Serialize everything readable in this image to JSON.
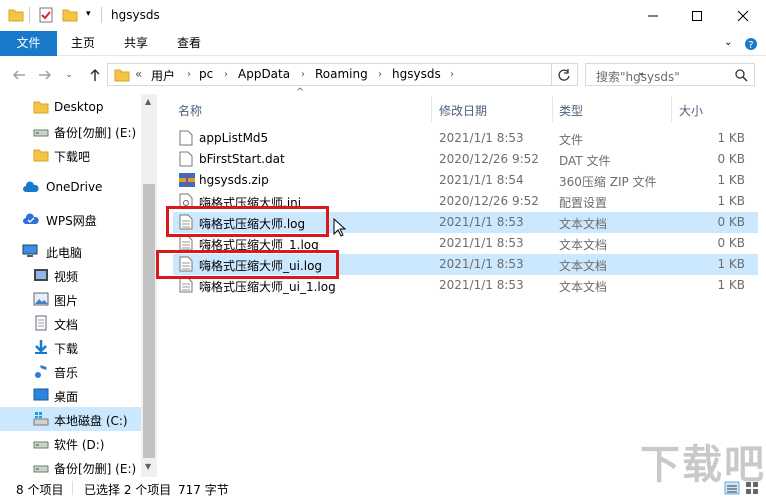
{
  "window": {
    "title": "hgsysds",
    "controls": [
      "minimize",
      "maximize",
      "close"
    ]
  },
  "ribbon": {
    "tabs": [
      {
        "label": "文件",
        "active": true
      },
      {
        "label": "主页"
      },
      {
        "label": "共享"
      },
      {
        "label": "查看"
      }
    ]
  },
  "address": {
    "overflow": "«",
    "crumbs": [
      "用户",
      "pc",
      "AppData",
      "Roaming",
      "hgsysds"
    ],
    "search_placeholder": "搜索\"hgsysds\""
  },
  "navpane": {
    "items": [
      {
        "label": "Desktop",
        "icon": "folder-icon"
      },
      {
        "label": "备份[勿删] (E:)",
        "icon": "drive-icon"
      },
      {
        "label": "下载吧",
        "icon": "folder-icon"
      },
      {
        "label": "OneDrive",
        "icon": "cloud-icon"
      },
      {
        "label": "WPS网盘",
        "icon": "wps-cloud-icon"
      },
      {
        "label": "此电脑",
        "icon": "computer-icon"
      },
      {
        "label": "视频",
        "icon": "video-icon"
      },
      {
        "label": "图片",
        "icon": "pictures-icon"
      },
      {
        "label": "文档",
        "icon": "documents-icon"
      },
      {
        "label": "下载",
        "icon": "download-icon"
      },
      {
        "label": "音乐",
        "icon": "music-icon"
      },
      {
        "label": "桌面",
        "icon": "desktop-icon"
      },
      {
        "label": "本地磁盘 (C:)",
        "icon": "system-drive-icon",
        "selected": true
      },
      {
        "label": "软件 (D:)",
        "icon": "drive-icon"
      },
      {
        "label": "备份[勿删] (E:)",
        "icon": "drive-icon"
      }
    ]
  },
  "filelist": {
    "columns": [
      "名称",
      "修改日期",
      "类型",
      "大小"
    ],
    "rows": [
      {
        "name": "appListMd5",
        "date": "2021/1/1 8:53",
        "type": "文件",
        "size": "1 KB",
        "icon": "file-icon"
      },
      {
        "name": "bFirstStart.dat",
        "date": "2020/12/26 9:52",
        "type": "DAT 文件",
        "size": "0 KB",
        "icon": "file-icon"
      },
      {
        "name": "hgsysds.zip",
        "date": "2021/1/1 8:54",
        "type": "360压缩 ZIP 文件",
        "size": "1 KB",
        "icon": "zip-icon"
      },
      {
        "name": "嗨格式压缩大师.ini",
        "date": "2020/12/26 9:52",
        "type": "配置设置",
        "size": "1 KB",
        "icon": "settings-file-icon"
      },
      {
        "name": "嗨格式压缩大师.log",
        "date": "2021/1/1 8:53",
        "type": "文本文档",
        "size": "0 KB",
        "icon": "text-file-icon",
        "selected": true
      },
      {
        "name": "嗨格式压缩大师_1.log",
        "date": "2021/1/1 8:53",
        "type": "文本文档",
        "size": "0 KB",
        "icon": "text-file-icon"
      },
      {
        "name": "嗨格式压缩大师_ui.log",
        "date": "2021/1/1 8:53",
        "type": "文本文档",
        "size": "1 KB",
        "icon": "text-file-icon",
        "selected": true
      },
      {
        "name": "嗨格式压缩大师_ui_1.log",
        "date": "2021/1/1 8:53",
        "type": "文本文档",
        "size": "1 KB",
        "icon": "text-file-icon"
      }
    ]
  },
  "status": {
    "count": "8 个项目",
    "selected": "已选择 2 个项目",
    "size": "717 字节"
  },
  "watermark": "下载吧",
  "colors": {
    "accent": "#1979ca",
    "selection": "#cce8ff",
    "highlight_box": "#d9191b"
  }
}
